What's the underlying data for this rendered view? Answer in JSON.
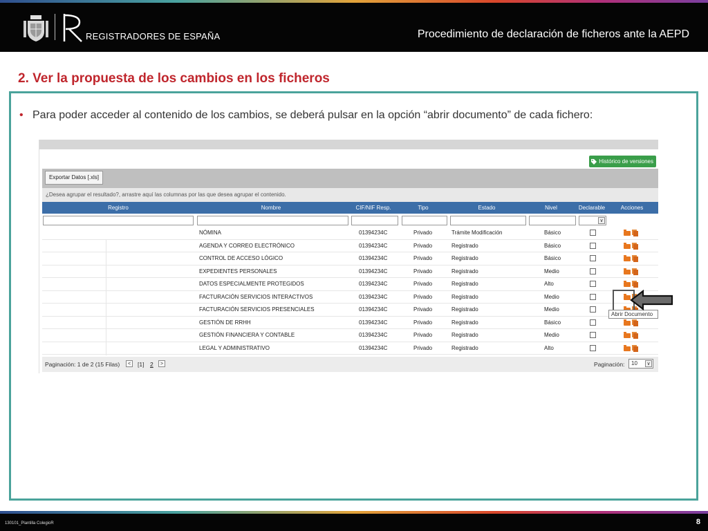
{
  "header": {
    "logo_text": "REGISTRADORES DE ESPAÑA",
    "title": "Procedimiento de declaración de ficheros ante la AEPD"
  },
  "section": {
    "title": "2. Ver la propuesta de los cambios en los ficheros",
    "bullet_symbol": "•",
    "bullet_text": "Para poder acceder al contenido de los cambios, se deberá pulsar en la opción  “abrir documento” de cada fichero:"
  },
  "app": {
    "history_button": "Histórico de versiones",
    "export_button": "Exportar Datos [.xls]",
    "group_hint": "¿Desea agrupar el resultado?, arrastre aquí las columnas por las que desea agrupar el contenido.",
    "columns": [
      "Registro",
      "Nombre",
      "CIF/NIF Resp.",
      "Tipo",
      "Estado",
      "Nivel",
      "Declarable",
      "Acciones"
    ],
    "rows": [
      {
        "nombre": "NÓMINA",
        "cif": "01394234C",
        "tipo": "Privado",
        "estado": "Trámite Modificación",
        "nivel": "Básico"
      },
      {
        "nombre": "AGENDA Y CORREO ELECTRÓNICO",
        "cif": "01394234C",
        "tipo": "Privado",
        "estado": "Registrado",
        "nivel": "Básico"
      },
      {
        "nombre": "CONTROL DE ACCESO LÓGICO",
        "cif": "01394234C",
        "tipo": "Privado",
        "estado": "Registrado",
        "nivel": "Básico"
      },
      {
        "nombre": "EXPEDIENTES PERSONALES",
        "cif": "01394234C",
        "tipo": "Privado",
        "estado": "Registrado",
        "nivel": "Medio"
      },
      {
        "nombre": "DATOS ESPECIALMENTE PROTEGIDOS",
        "cif": "01394234C",
        "tipo": "Privado",
        "estado": "Registrado",
        "nivel": "Alto"
      },
      {
        "nombre": "FACTURACIÓN SERVICIOS INTERACTIVOS",
        "cif": "01394234C",
        "tipo": "Privado",
        "estado": "Registrado",
        "nivel": "Medio"
      },
      {
        "nombre": "FACTURACIÓN SERVICIOS PRESENCIALES",
        "cif": "01394234C",
        "tipo": "Privado",
        "estado": "Registrado",
        "nivel": "Medio"
      },
      {
        "nombre": "GESTIÓN DE RRHH",
        "cif": "01394234C",
        "tipo": "Privado",
        "estado": "Registrado",
        "nivel": "Básico"
      },
      {
        "nombre": "GESTIÓN FINANCIERA Y CONTABLE",
        "cif": "01394234C",
        "tipo": "Privado",
        "estado": "Registrado",
        "nivel": "Medio"
      },
      {
        "nombre": "LEGAL Y ADMINISTRATIVO",
        "cif": "01394234C",
        "tipo": "Privado",
        "estado": "Registrado",
        "nivel": "Alto"
      }
    ],
    "pager": {
      "text": "Paginación: 1 de 2 (15 Filas)",
      "prev": "<",
      "current": "[1]",
      "page2": "2",
      "next": ">",
      "size_label": "Paginación:",
      "size_value": "10",
      "dropdown_arrow": "∨"
    },
    "tooltip": "Abrir Documento"
  },
  "footer": {
    "left": "130101_Plantilla ColegioR",
    "page": "8"
  },
  "colors": {
    "header_bg": "#050505",
    "accent_red": "#c0262d",
    "frame_teal": "#4aa39b",
    "grid_header": "#3c6ea8",
    "history_green": "#3a9e4a",
    "action_orange": "#e8771e"
  },
  "icons": [
    "spain-crest-icon",
    "registradores-r-logo",
    "tag-icon",
    "folder-icon",
    "documents-icon",
    "arrow-left-icon"
  ]
}
